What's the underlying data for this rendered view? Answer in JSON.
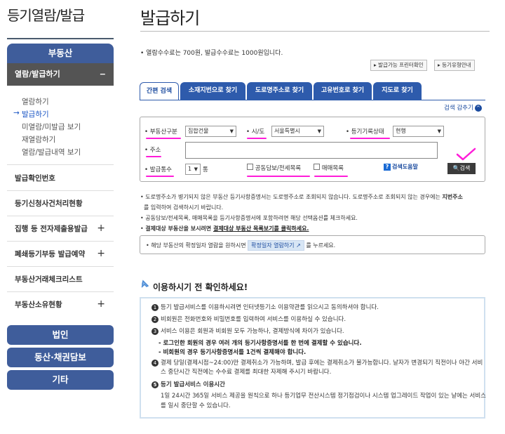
{
  "sidebar": {
    "title": "등기열람/발급",
    "cat_realestate": "부동산",
    "menu_open": {
      "label": "열람/발급하기",
      "sign": "−"
    },
    "subs": [
      "열람하기",
      "발급하기",
      "미열람/미발급 보기",
      "재열람하기",
      "열람/발급내역 보기"
    ],
    "active_arrow": "→",
    "items": [
      {
        "label": "발급확인번호",
        "sign": ""
      },
      {
        "label": "등기신청사건처리현황",
        "sign": ""
      },
      {
        "label": "집행 등 전자제출용발급",
        "sign": "+"
      },
      {
        "label": "폐쇄등기부등 발급예약",
        "sign": "+"
      },
      {
        "label": "부동산거래체크리스트",
        "sign": ""
      },
      {
        "label": "부동산소유현황",
        "sign": "+"
      }
    ],
    "cats": [
      "법인",
      "동산·채권담보",
      "기타"
    ]
  },
  "main": {
    "title": "발급하기",
    "fee": "• 열람수수료는 700원, 발급수수료는 1000원입니다.",
    "btn_program": "▸ 발급가능 프린터확인",
    "btn_type": "▸ 등기유형안내",
    "tabs": [
      "간편 검색",
      "소재지번으로 찾기",
      "도로명주소로 찾기",
      "고유번호로 찾기",
      "지도로 찾기"
    ],
    "collapse": "검색 감추기",
    "collapse_chev": "^",
    "form": {
      "realestate_type_label": "• 부동산구분",
      "realestate_type_value": "집합건물",
      "sido_label": "• 시/도",
      "sido_value": "서울특별시",
      "record_status_label": "• 등기기록상태",
      "record_status_value": "현행",
      "address_label": "• 주소",
      "count_label": "• 발급통수",
      "count_value": "1",
      "count_unit": "통",
      "chk_joint": "공동담보/전세목록",
      "chk_trade": "매매목록",
      "help": "검색도움말",
      "search": "검색"
    },
    "notes": [
      {
        "pre": "• 도로명주소가 병기되지 않은 부동산 등기사항증명서는 도로명주소로 조회되지 않습니다. 도로명주소로 조회되지 않는 경우에는 ",
        "bold": "지번주소",
        "post": ""
      },
      {
        "pre": "를 입력하여 검색하시기 바랍니다.",
        "bold": "",
        "post": ""
      },
      {
        "pre": "• 공동담보/전세목록, 매매목록을 등기사항증명서에 포함하려면 해당 선택옵션를 체크하세요.",
        "bold": "",
        "post": ""
      },
      {
        "pre": "• ",
        "bold": "결제대상 부동산을 보시려면 ",
        "post": "결제대상 부동산 목록보기를 클릭하세요."
      }
    ],
    "notice_pre": "• 해당 부동산의 확정일자 열람을 원하시면",
    "notice_btn": "확정일자 열람하기 ↗",
    "notice_post": "를 누르세요.",
    "check_title": "이용하시기 전 확인하세요!",
    "checks": [
      {
        "num": "1",
        "text": "등기 발급서비스를 이용하시려면 인터넷등기소 이용약관를 읽으시고 동의하셔야 합니다."
      },
      {
        "num": "2",
        "text": "비회원은 전화번호와 비밀번호를 입력하여 서비스를 이용하실 수 있습니다."
      },
      {
        "num": "3",
        "text": "서비스 이용은 회원과 비회원 모두 가능하나, 결제방식에 차이가 있습니다."
      },
      {
        "num": "4",
        "text": "결제 당일(결제시점~24:00)만 결제취소가 가능하며, 발급 후에는 결제취소가 불가능합니다. 날자가 변경되기 직전이나 야간 서비"
      },
      {
        "num": "5",
        "text": "등기 발급서비스 이용시간"
      }
    ],
    "check_sub1": "- 로그인한 회원의 경우 여러 개의 등기사항증명서를 한 번에 결제할 수 있습니다.",
    "check_sub2": "- 비회원의 경우 등기사항증명서를 1건씩 결제해야 합니다.",
    "check4_cont": "스 중단시간 직전에는 수수료 결제를 최대한 자제해 주시기 바랍니다.",
    "check5_cont1": "1일 24시간 365일 서비스 제공을 원칙으로 하나 등기업무 전산시스템 정기점검이나 시스템 업그레이드 작업이 있는 날에는 서비스",
    "check5_cont2": "를 일시 중단할 수 있습니다."
  },
  "colors": {
    "navy": "#3f5d9b",
    "tab_blue": "#2e5bac",
    "annotation": "#ff1cd9"
  }
}
